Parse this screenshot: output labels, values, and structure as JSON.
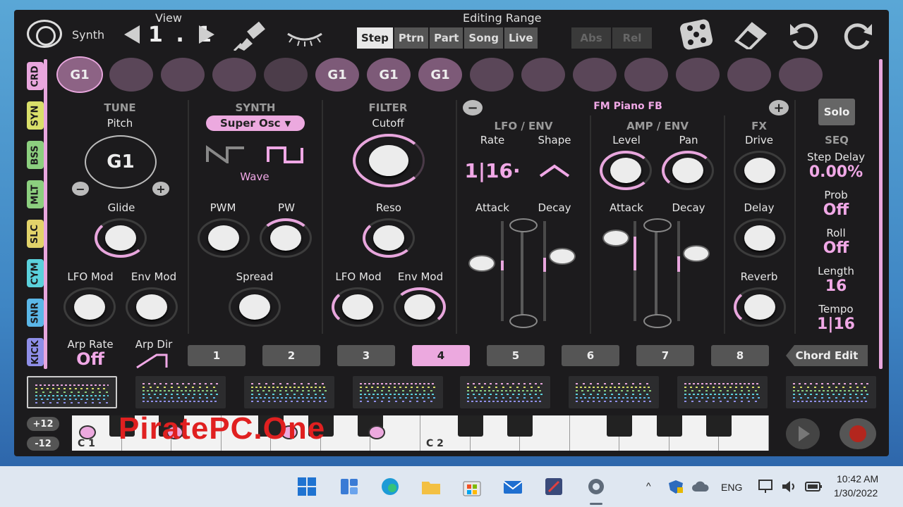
{
  "header": {
    "synth_label": "Synth",
    "view_label": "View",
    "view_value": "1 . 1",
    "editing_range_label": "Editing Range",
    "range_tabs": [
      "Step",
      "Ptrn",
      "Part",
      "Song",
      "Live"
    ],
    "mode_tabs": [
      "Abs",
      "Rel"
    ]
  },
  "instrument_tabs": [
    "CRD",
    "SYN",
    "BSS",
    "MLT",
    "SLC",
    "CYM",
    "SNR",
    "KICK"
  ],
  "instrument_colors": [
    "#e8a6dd",
    "#d9df6a",
    "#8ccf7f",
    "#8ccf7f",
    "#e2d36a",
    "#5bd1dc",
    "#5bb7e8",
    "#8f8fe8"
  ],
  "pads": [
    "G1",
    "",
    "",
    "",
    "",
    "G1",
    "G1",
    "G1",
    "",
    "",
    "",
    "",
    "",
    "",
    ""
  ],
  "tune": {
    "title": "TUNE",
    "pitch_label": "Pitch",
    "pitch_value": "G1",
    "glide_label": "Glide",
    "lfo_mod_label": "LFO Mod",
    "env_mod_label": "Env Mod",
    "arp_rate_label": "Arp Rate",
    "arp_rate_value": "Off",
    "arp_dir_label": "Arp Dir"
  },
  "synth": {
    "title": "SYNTH",
    "osc_select": "Super Osc",
    "wave_label": "Wave",
    "pwm_label": "PWM",
    "pw_label": "PW",
    "spread_label": "Spread"
  },
  "filter": {
    "title": "FILTER",
    "cutoff_label": "Cutoff",
    "reso_label": "Reso",
    "lfo_mod_label": "LFO Mod",
    "env_mod_label": "Env Mod"
  },
  "preset_name": "FM Piano FB",
  "lfo_env": {
    "title": "LFO / ENV",
    "rate_label": "Rate",
    "shape_label": "Shape",
    "rate_value": "1|16·",
    "attack_label": "Attack",
    "decay_label": "Decay"
  },
  "amp_env": {
    "title": "AMP / ENV",
    "level_label": "Level",
    "pan_label": "Pan",
    "attack_label": "Attack",
    "decay_label": "Decay"
  },
  "fx": {
    "title": "FX",
    "drive_label": "Drive",
    "delay_label": "Delay",
    "reverb_label": "Reverb"
  },
  "seq": {
    "solo_label": "Solo",
    "title": "SEQ",
    "step_delay_label": "Step Delay",
    "step_delay_value": "0.00%",
    "prob_label": "Prob",
    "prob_value": "Off",
    "roll_label": "Roll",
    "roll_value": "Off",
    "length_label": "Length",
    "length_value": "16",
    "tempo_label": "Tempo",
    "tempo_value": "1|16"
  },
  "patterns": [
    "1",
    "2",
    "3",
    "4",
    "5",
    "6",
    "7",
    "8"
  ],
  "active_pattern": "4",
  "chord_edit_label": "Chord Edit",
  "octave_up": "+12",
  "octave_down": "-12",
  "key_labels": [
    "C 1",
    "C 2"
  ],
  "watermark": "PiratePC.One",
  "taskbar": {
    "lang": "ENG",
    "time": "10:42 AM",
    "date": "1/30/2022"
  }
}
